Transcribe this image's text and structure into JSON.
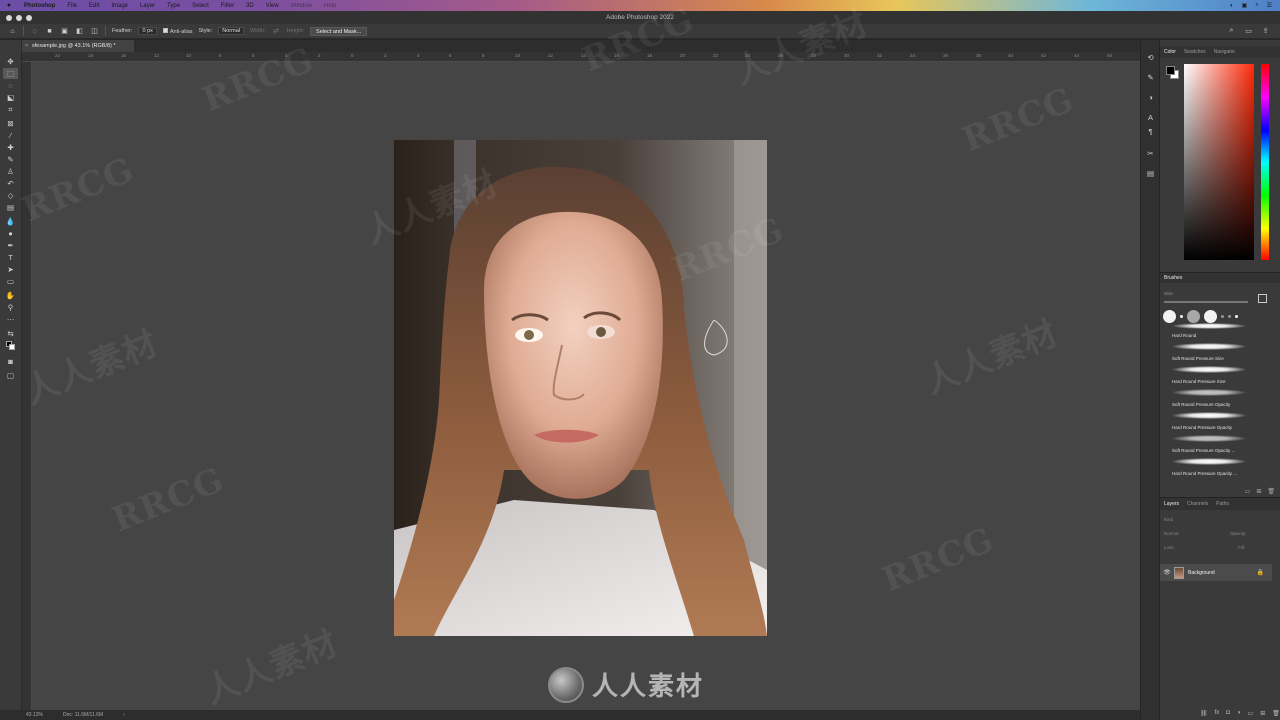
{
  "menubar": {
    "app": "Photoshop",
    "items": [
      "File",
      "Edit",
      "Image",
      "Layer",
      "Type",
      "Select",
      "Filter",
      "3D",
      "View",
      "Window",
      "Help"
    ],
    "right_items": [
      "◐",
      "▣",
      "⌕",
      "☰"
    ]
  },
  "window": {
    "title": "Adobe Photoshop 2022"
  },
  "options": {
    "feather_label": "Feather:",
    "feather_value": "0 px",
    "antialias_label": "Anti-alias",
    "style_label": "Style:",
    "style_value": "Normal",
    "width_label": "Width:",
    "height_label": "Height:",
    "select_mask_label": "Select and Mask..."
  },
  "document": {
    "tab_title": "sfexample.jpg @ 43.1% (RGB/8) *",
    "close_glyph": "×"
  },
  "ruler_ticks": [
    "22",
    "18",
    "16",
    "12",
    "10",
    "8",
    "6",
    "4",
    "2",
    "0",
    "2",
    "4",
    "6",
    "8",
    "10",
    "12",
    "14",
    "16",
    "18",
    "20",
    "22",
    "24",
    "26",
    "28",
    "30",
    "32",
    "34",
    "36",
    "38",
    "40",
    "42",
    "44",
    "46"
  ],
  "statusbar": {
    "zoom": "43.13%",
    "doc": "Doc: 11.6M/11.6M",
    "arrow": "›"
  },
  "panels": {
    "color_tabs": [
      "Color",
      "Swatches",
      "Navigator"
    ],
    "brushes_title": "Brushes",
    "brushes_size_label": "Size",
    "brushes": [
      "Hard Round",
      "Soft Round Pressure Size",
      "Hard Round Pressure Size",
      "Soft Round Pressure Opacity",
      "Hard Round Pressure Opacity",
      "Soft Round Pressure Opacity ...",
      "Hard Round Pressure Opacity ..."
    ],
    "layer_tabs": [
      "Layers",
      "Channels",
      "Paths"
    ],
    "layers_kind": "Kind",
    "layers_mode": "Normal",
    "layers_opacity": "Opacity:",
    "layers_lock": "Lock:",
    "layers_fill": "Fill:",
    "layers": [
      {
        "name": "Background",
        "visible": true,
        "locked": true
      }
    ]
  },
  "watermark": {
    "text_latin": "RRCG",
    "text_cn": "人人素材",
    "logo_text": "人人素材"
  },
  "colors": {
    "fg": "#000000",
    "bg": "#ffffff",
    "canvas": "#454545"
  }
}
